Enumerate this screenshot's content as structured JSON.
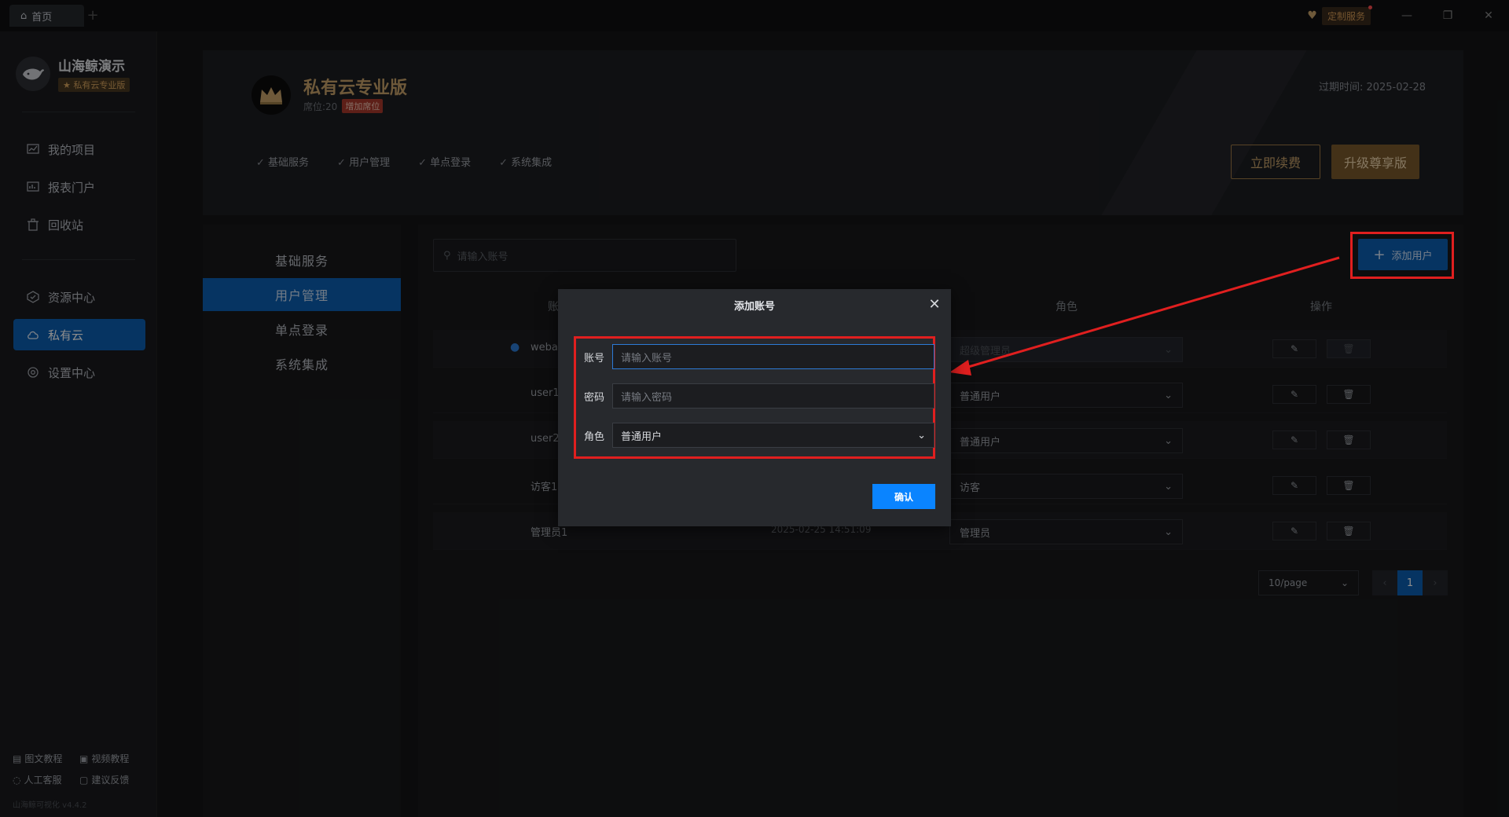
{
  "titlebar": {
    "tab_home_label": "首页",
    "tab_add_label": "+",
    "custom_service_label": "定制服务"
  },
  "sidebar": {
    "profile_name": "山海鲸演示",
    "edition_tag": "★ 私有云专业版",
    "nav": [
      {
        "label": "我的项目",
        "icon": "chart-icon"
      },
      {
        "label": "报表门户",
        "icon": "report-icon"
      },
      {
        "label": "回收站",
        "icon": "trash-icon"
      },
      {
        "label": "资源中心",
        "icon": "cube-icon"
      },
      {
        "label": "私有云",
        "icon": "cloud-icon",
        "active": true
      },
      {
        "label": "设置中心",
        "icon": "gear-icon"
      }
    ],
    "footer_links": [
      "图文教程",
      "视频教程",
      "人工客服",
      "建议反馈"
    ],
    "version": "山海鲸可视化 v4.4.2"
  },
  "header": {
    "plan_title": "私有云专业版",
    "seats": "席位:20",
    "add_seat_label": "增加席位",
    "features": [
      "基础服务",
      "用户管理",
      "单点登录",
      "系统集成"
    ],
    "expire": "过期时间: 2025-02-28",
    "renew_label": "立即续费",
    "upgrade_label": "升级尊享版"
  },
  "subnav": {
    "items": [
      "基础服务",
      "用户管理",
      "单点登录",
      "系统集成"
    ],
    "active_index": 1
  },
  "search": {
    "placeholder": "请输入账号"
  },
  "add_user_label": "添加用户",
  "table": {
    "headers": {
      "account": "账",
      "role": "角色",
      "ops": "操作"
    },
    "rows": [
      {
        "account": "webad",
        "time": "",
        "role": "超级管理员",
        "disabled": true
      },
      {
        "account": "user1",
        "time": "",
        "role": "普通用户",
        "disabled": false
      },
      {
        "account": "user2",
        "time": "",
        "role": "普通用户",
        "disabled": false
      },
      {
        "account": "访客1",
        "time": "",
        "role": "访客",
        "disabled": false
      },
      {
        "account": "管理员1",
        "time": "2025-02-25 14:51:09",
        "role": "管理员",
        "disabled": false
      }
    ]
  },
  "pagination": {
    "page_size": "10/page",
    "current_page": "1"
  },
  "dialog": {
    "title": "添加账号",
    "account_label": "账号",
    "account_placeholder": "请输入账号",
    "password_label": "密码",
    "password_placeholder": "请输入密码",
    "role_label": "角色",
    "role_value": "普通用户",
    "confirm_label": "确认"
  },
  "colors": {
    "accent": "#0c5fb2",
    "gold": "#c9a36a",
    "highlight": "#e01f1f",
    "confirm": "#0a84ff"
  }
}
